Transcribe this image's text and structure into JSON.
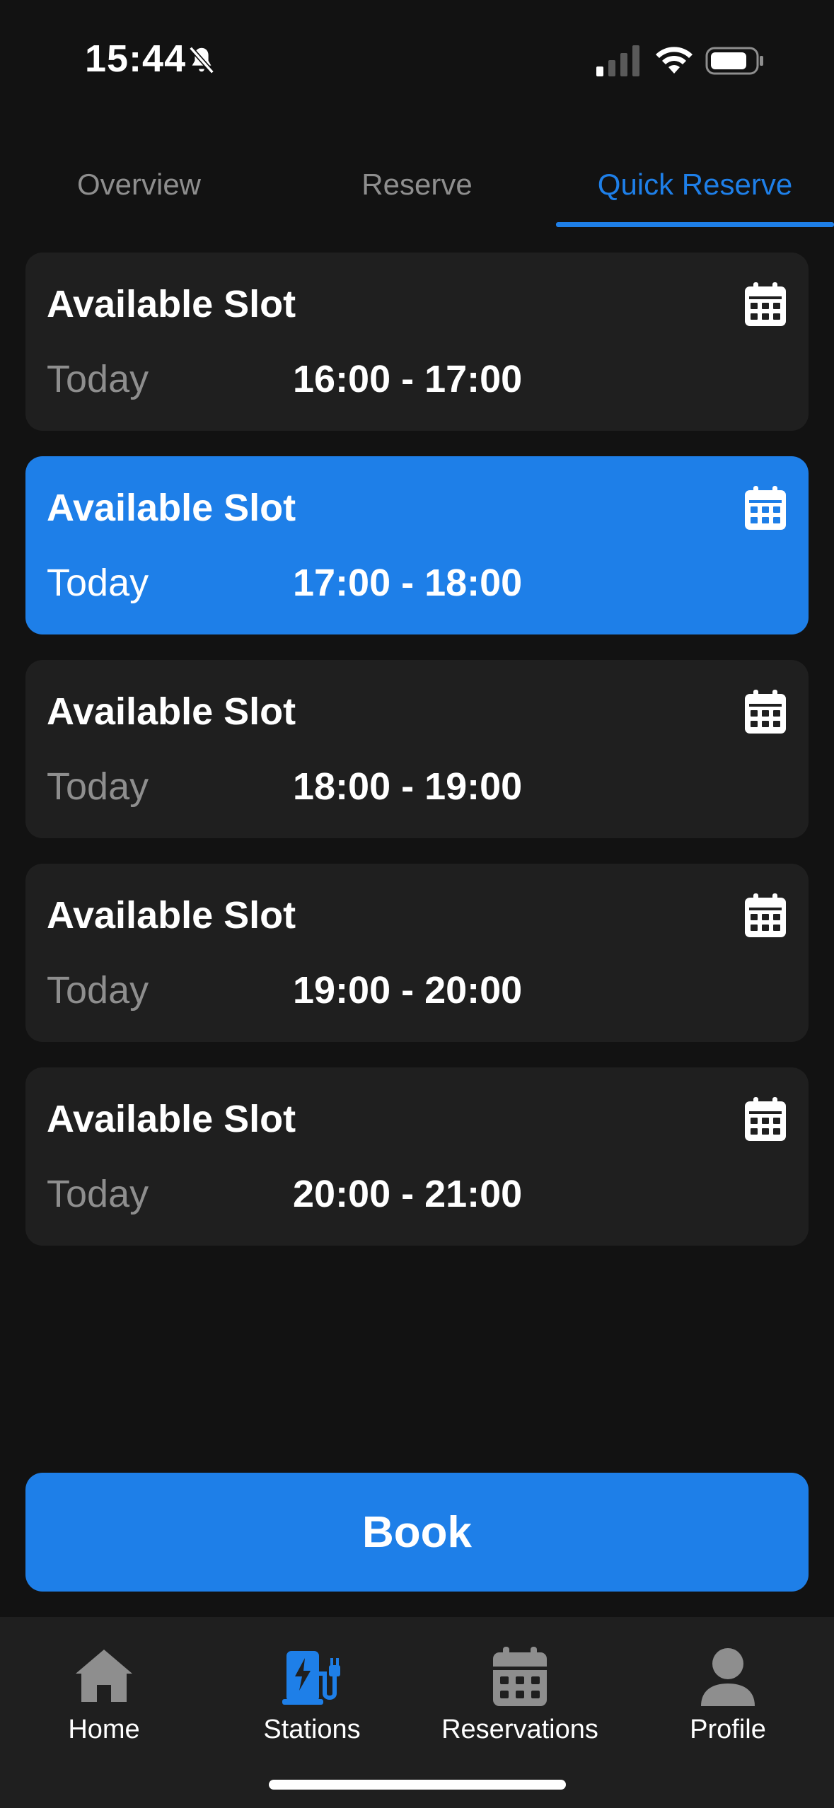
{
  "status_bar": {
    "time": "15:44"
  },
  "tabs": [
    {
      "label": "Overview",
      "active": false
    },
    {
      "label": "Reserve",
      "active": false
    },
    {
      "label": "Quick Reserve",
      "active": true
    }
  ],
  "slots": [
    {
      "title": "Available Slot",
      "day": "Today",
      "time": "16:00 - 17:00",
      "selected": false
    },
    {
      "title": "Available Slot",
      "day": "Today",
      "time": "17:00 - 18:00",
      "selected": true
    },
    {
      "title": "Available Slot",
      "day": "Today",
      "time": "18:00 - 19:00",
      "selected": false
    },
    {
      "title": "Available Slot",
      "day": "Today",
      "time": "19:00 - 20:00",
      "selected": false
    },
    {
      "title": "Available Slot",
      "day": "Today",
      "time": "20:00 - 21:00",
      "selected": false
    }
  ],
  "book_button": {
    "label": "Book"
  },
  "bottom_nav": [
    {
      "label": "Home",
      "icon": "home-icon",
      "active": false
    },
    {
      "label": "Stations",
      "icon": "ev-charger-icon",
      "active": true
    },
    {
      "label": "Reservations",
      "icon": "calendar-icon",
      "active": false
    },
    {
      "label": "Profile",
      "icon": "user-icon",
      "active": false
    }
  ],
  "colors": {
    "accent": "#1e7fe8",
    "background": "#121212",
    "card": "#1f1f1f",
    "muted_text": "#8e8e8e",
    "inactive_icon": "#8e8e8e"
  }
}
